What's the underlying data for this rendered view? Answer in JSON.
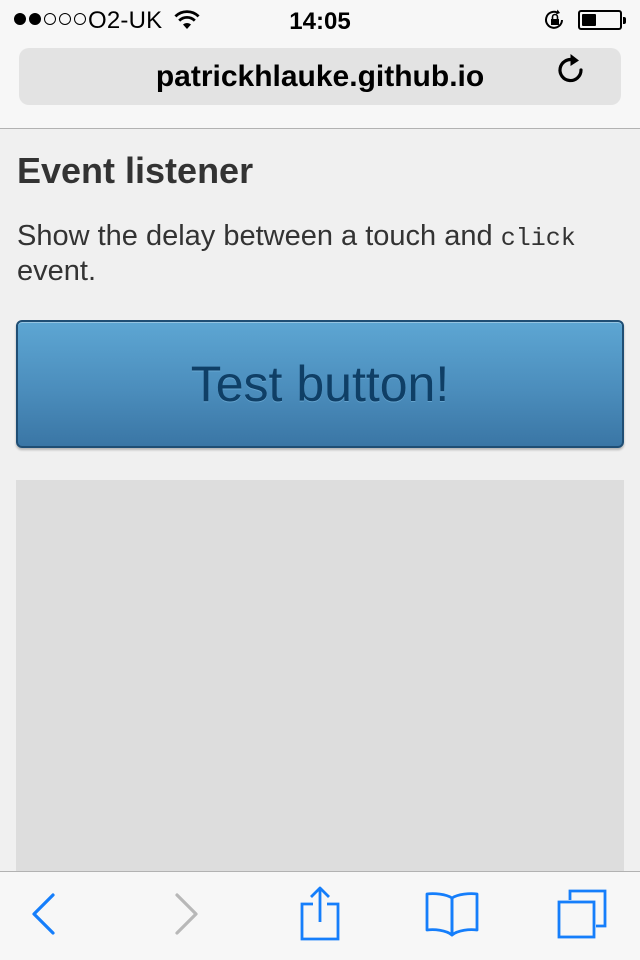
{
  "status_bar": {
    "signal_bars": 5,
    "signal_filled": 2,
    "carrier": "O2-UK",
    "wifi_icon": "wifi-icon",
    "time": "14:05",
    "orientation_lock_icon": "rotation-lock-icon",
    "battery_level": 0.4
  },
  "url_bar": {
    "url": "patrickhlauke.github.io",
    "reload_icon": "reload-icon"
  },
  "page": {
    "title": "Event listener",
    "description_before": "Show the delay between a touch and ",
    "description_code": "click",
    "description_after": " event.",
    "button_label": "Test button!",
    "output_text": ""
  },
  "toolbar": {
    "back_icon": "chevron-left-icon",
    "forward_icon": "chevron-right-icon",
    "share_icon": "share-icon",
    "bookmarks_icon": "book-icon",
    "tabs_icon": "tabs-icon"
  },
  "colors": {
    "accent": "#157efb",
    "disabled": "#b8b8b8",
    "button_top": "#5da6d3",
    "button_bottom": "#3a76a5",
    "button_text": "#0f3f66"
  }
}
